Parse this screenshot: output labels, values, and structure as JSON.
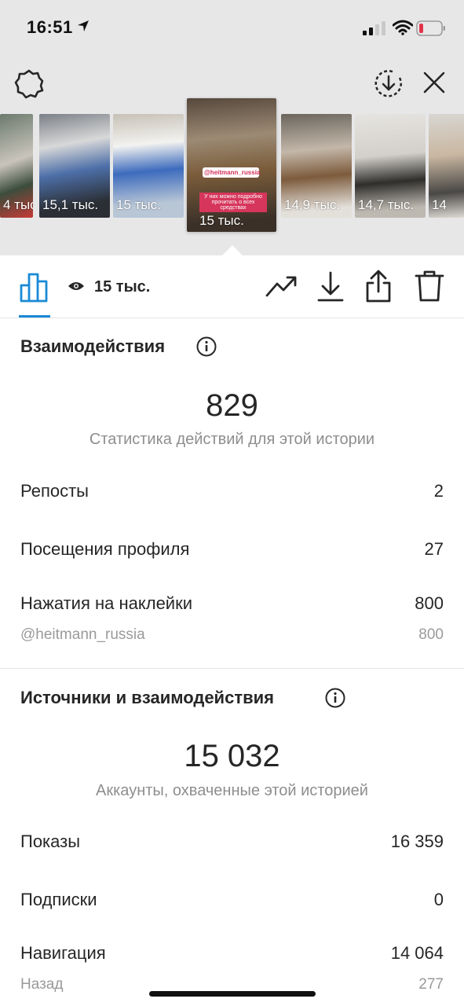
{
  "status_bar": {
    "time": "16:51"
  },
  "colors": {
    "header_bg": "#e7e7e8",
    "accent": "#1a8ad6",
    "text": "#262626",
    "muted": "#8e8e8e",
    "battery_low": "#e2334b"
  },
  "icons": [
    "gear-icon",
    "download-circle-icon",
    "close-icon",
    "bar-chart-icon",
    "eye-icon",
    "trend-icon",
    "download-icon",
    "share-icon",
    "trash-icon",
    "info-icon"
  ],
  "thumbnails": [
    {
      "views": "4 тыс."
    },
    {
      "views": "15,1 тыс."
    },
    {
      "views": "15 тыс."
    },
    {
      "views": "15 тыс.",
      "sticker": "@heitmann_russia",
      "caption": "У них можно подробно прочитать о всех средствах"
    },
    {
      "views": "14,9 тыс."
    },
    {
      "views": "14,7 тыс."
    },
    {
      "views": "14"
    }
  ],
  "toolbar": {
    "views": "15 тыс."
  },
  "interactions": {
    "title": "Взаимодействия",
    "total": "829",
    "subtitle": "Статистика действий для этой истории",
    "rows": [
      {
        "label": "Репосты",
        "value": "2"
      },
      {
        "label": "Посещения профиля",
        "value": "27"
      },
      {
        "label": "Нажатия на наклейки",
        "value": "800"
      }
    ],
    "sticker_sub": {
      "label": "@heitmann_russia",
      "value": "800"
    }
  },
  "discovery": {
    "title": "Источники и взаимодействия",
    "total": "15 032",
    "subtitle": "Аккаунты, охваченные этой историей",
    "rows": [
      {
        "label": "Показы",
        "value": "16 359"
      },
      {
        "label": "Подписки",
        "value": "0"
      },
      {
        "label": "Навигация",
        "value": "14 064"
      }
    ],
    "nav_sub": {
      "label": "Назад",
      "value": "277"
    }
  }
}
